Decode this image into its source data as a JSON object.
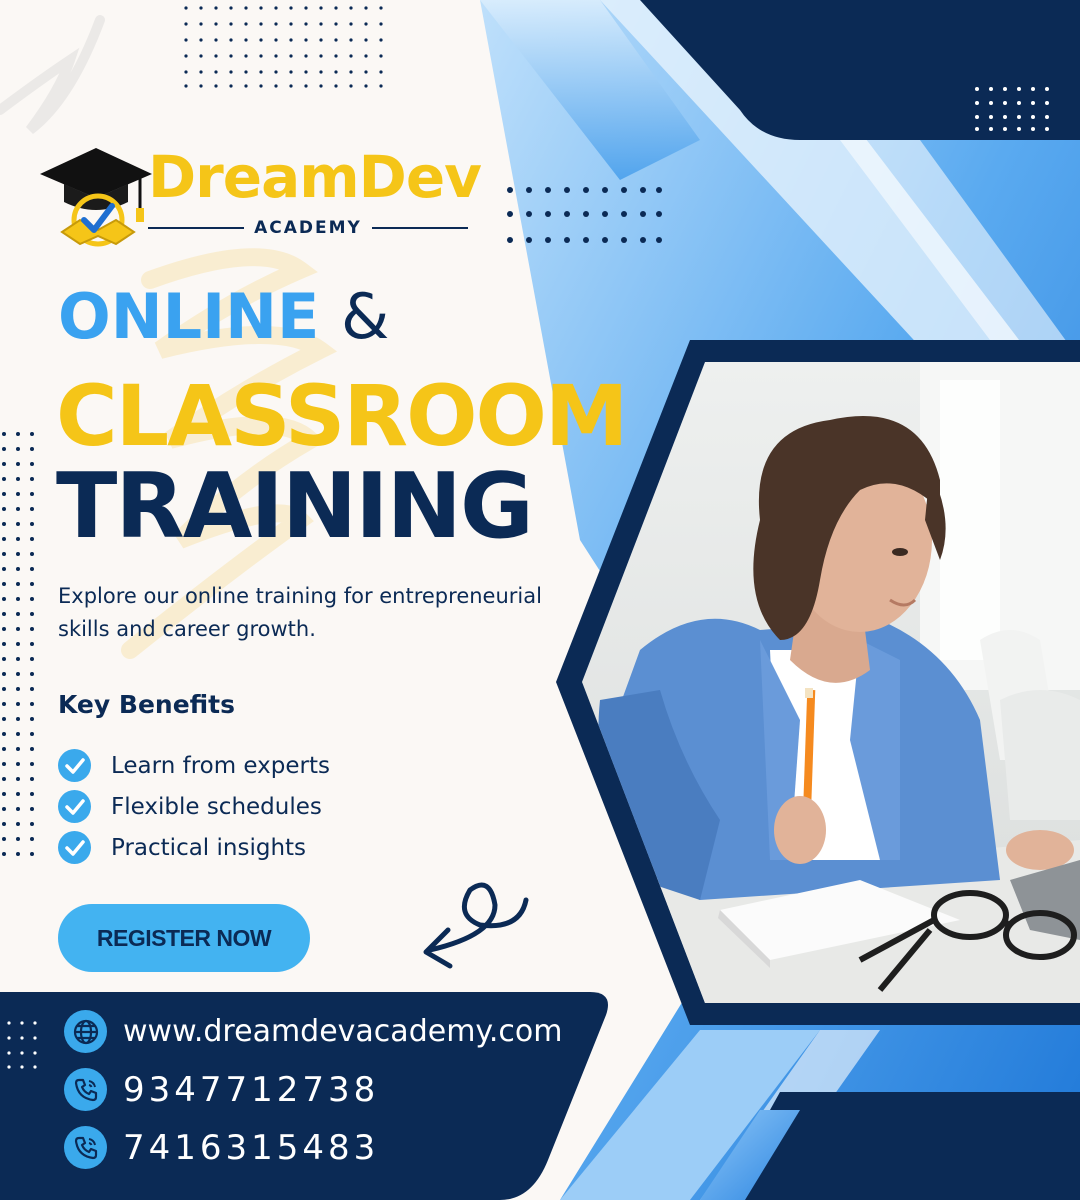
{
  "brand": {
    "name_part1": "Dream",
    "name_part2": "Dev",
    "tagline": "ACADEMY",
    "logo_icon": "graduation-cap-book-check-icon"
  },
  "headline": {
    "line1_word": "ONLINE",
    "line1_amp": "&",
    "line2": "CLASSROOM",
    "line3": "TRAINING"
  },
  "description": "Explore our online training for entrepreneurial skills and career growth.",
  "benefits": {
    "title": "Key Benefits",
    "items": [
      {
        "label": "Learn from experts",
        "icon": "check-circle-icon"
      },
      {
        "label": "Flexible schedules",
        "icon": "check-circle-icon"
      },
      {
        "label": "Practical insights",
        "icon": "check-circle-icon"
      }
    ]
  },
  "cta": {
    "label": "REGISTER NOW"
  },
  "contact": {
    "website": {
      "icon": "globe-icon",
      "text": "www.dreamdevacademy.com"
    },
    "phones": [
      {
        "icon": "phone-icon",
        "text": "9347712738"
      },
      {
        "icon": "phone-icon",
        "text": "7416315483"
      }
    ]
  },
  "colors": {
    "navy": "#0b2a55",
    "sky_blue": "#3aa9ec",
    "yellow": "#f5c518",
    "cream": "#fbf8f5"
  },
  "photo": {
    "subject": "woman with pencil studying at laptop"
  }
}
